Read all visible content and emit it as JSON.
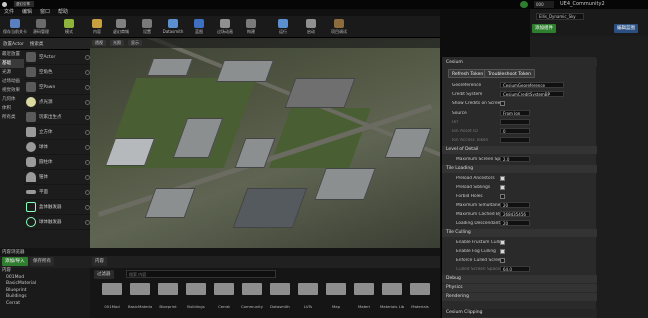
{
  "window": {
    "title": "虚幻引擎",
    "tab2": "UE4_Community2",
    "tab_doc": "000"
  },
  "menu": [
    "文件",
    "编辑",
    "窗口",
    "帮助"
  ],
  "toolbar": [
    {
      "label": "保存当前关卡",
      "color": "#5a7fbf",
      "name": "save-icon"
    },
    {
      "label": "源码管理",
      "color": "#6a6a6a",
      "name": "source-control-icon"
    },
    {
      "label": "模式",
      "color": "#8fb33b",
      "name": "modes-icon"
    },
    {
      "label": "内容",
      "color": "#c8a040",
      "name": "content-icon"
    },
    {
      "label": "虚幻商城",
      "color": "#808080",
      "name": "marketplace-icon"
    },
    {
      "label": "设置",
      "color": "#7a7a7a",
      "name": "settings-icon"
    },
    {
      "label": "Datasmith",
      "color": "#5a8fd0",
      "name": "datasmith-icon"
    },
    {
      "label": "蓝图",
      "color": "#3f6fc0",
      "name": "blueprint-icon"
    },
    {
      "label": "过场动画",
      "color": "#909090",
      "name": "cinematics-icon"
    },
    {
      "label": "构建",
      "color": "#7a7a7a",
      "name": "build-icon"
    },
    {
      "label": "运行",
      "color": "#5a8fd0",
      "name": "play-icon"
    },
    {
      "label": "启动",
      "color": "#909090",
      "name": "launch-icon"
    },
    {
      "label": "项目调试",
      "color": "#8c6b3c",
      "name": "debug-icon"
    }
  ],
  "modes": {
    "tab1": "放置Actor",
    "tab2": "搜索类",
    "categories": [
      "最近放置",
      "基础",
      "光源",
      "过场动画",
      "视觉效果",
      "几何体",
      "体积",
      "所有类"
    ],
    "items": [
      "空Actor",
      "空角色",
      "空Pawn",
      "点光源",
      "玩家出生点",
      "立方体",
      "球体",
      "圆柱体",
      "锥体",
      "平面",
      "盒体触发器",
      "球体触发器"
    ]
  },
  "viewport": {
    "tools": [
      "透视",
      "光照",
      "显示"
    ]
  },
  "content_browser": {
    "tab": "内容浏览器",
    "add_label": "添加/导入",
    "save_label": "保存所有",
    "path": "内容",
    "filter": "过滤器",
    "search_placeholder": "搜索 内容",
    "tree": [
      "内容",
      "001Mod",
      "BasicMaterial",
      "Blueprint",
      "Buildings",
      "Cerrat"
    ],
    "folders": [
      "001Mod",
      "BasicMaterial",
      "Blueprint",
      "Buildings",
      "Cerrat",
      "Community",
      "Datasmith",
      "LUTs",
      "Map",
      "Materi",
      "Materials Library",
      "Materials"
    ]
  },
  "cesium": {
    "title": "Cesium",
    "btn_refresh": "Refresh Token",
    "btn_troubleshoot": "Troubleshoot Token",
    "rows": [
      {
        "k": "Georeference",
        "v": "CesiumGeoreference",
        "type": "text"
      },
      {
        "k": "Credit System",
        "v": "CesiumCreditSystemBP",
        "type": "text"
      },
      {
        "k": "Show Credits on Screen",
        "type": "check",
        "on": false
      },
      {
        "k": "Source",
        "v": "From Ion",
        "type": "text"
      },
      {
        "k": "Url",
        "v": "",
        "type": "text",
        "dim": true
      },
      {
        "k": "Ion Asset ID",
        "v": "0",
        "type": "text",
        "dim": true
      },
      {
        "k": "Ion Access Token",
        "v": "",
        "type": "text",
        "dim": true
      }
    ],
    "lod_section": "Level of Detail",
    "max_sse_label": "Maximum Screen Space",
    "max_sse": "2.0",
    "tile_loading_section": "Tile Loading",
    "tile_loading": [
      {
        "k": "Preload Ancestors",
        "on": true
      },
      {
        "k": "Preload Siblings",
        "on": true
      },
      {
        "k": "Forbid Holes",
        "on": false
      }
    ],
    "max_loads_label": "Maximum Simultaneous",
    "max_loads": "20",
    "max_cache_label": "Maximum Cached Byt",
    "max_cache": "268435456",
    "loading_desc_label": "Loading Descendant Li",
    "loading_desc": "20",
    "tile_culling_section": "Tile Culling",
    "culling": [
      {
        "k": "Enable Frustum Culling",
        "on": true
      },
      {
        "k": "Enable Fog Culling",
        "on": true
      },
      {
        "k": "Enforce Culled Screen S",
        "on": false
      }
    ],
    "culled_sse_label": "Culled Screen Space E",
    "culled_sse": "64.0",
    "sections_more": [
      "Debug",
      "Physics",
      "Rendering"
    ],
    "clip_section": "Cesium Clipping"
  },
  "right_panel": {
    "btn_add": "添加组件",
    "btn_bp": "编辑蓝图",
    "actor_name": "Ellis_Dynamic_Sky"
  }
}
